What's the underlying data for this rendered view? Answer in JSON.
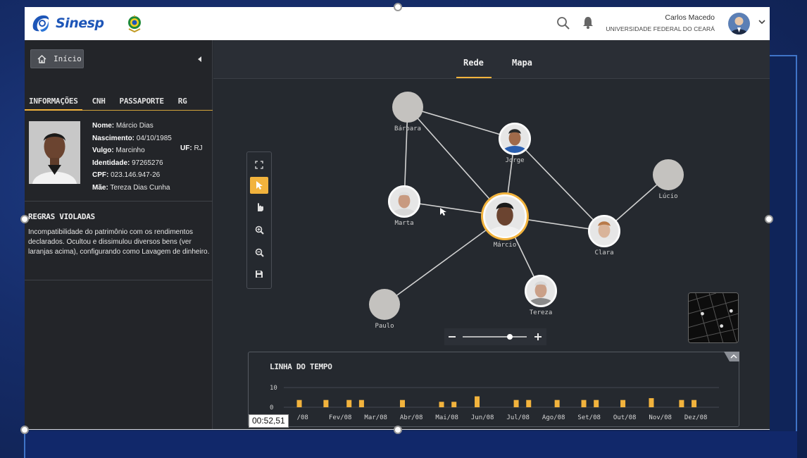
{
  "header": {
    "logo_text": "Sinesp",
    "user_name": "Carlos Macedo",
    "user_org": "UNIVERSIDADE FEDERAL DO CEARÁ"
  },
  "sidebar": {
    "home_label": "Início",
    "tabs": [
      "INFORMAÇÕES",
      "CNH",
      "PASSAPORTE",
      "RG"
    ],
    "active_tab": "INFORMAÇÕES",
    "person": {
      "nome_label": "Nome:",
      "nome": "Márcio Dias",
      "nascimento_label": "Nascimento:",
      "nascimento": "04/10/1985",
      "vulgo_label": "Vulgo:",
      "vulgo": "Marcinho",
      "uf_label": "UF:",
      "uf": "RJ",
      "identidade_label": "Identidade:",
      "identidade": "97265276",
      "cpf_label": "CPF:",
      "cpf": "023.146.947-26",
      "mae_label": "Mãe:",
      "mae": "Tereza Dias Cunha"
    },
    "rules_title": "REGRAS VIOLADAS",
    "rules_text": "Incompatibilidade do patrimônio com os rendimentos declarados. Ocultou e dissimulou diversos bens (ver laranjas acima), configurando como Lavagem de dinheiro."
  },
  "main": {
    "tabs": [
      "Rede",
      "Mapa"
    ],
    "active_tab": "Rede"
  },
  "graph": {
    "nodes": [
      {
        "id": "barbara",
        "label": "Bárbara",
        "photo": false
      },
      {
        "id": "jorge",
        "label": "Jorge",
        "photo": true
      },
      {
        "id": "lucio",
        "label": "Lúcio",
        "photo": false
      },
      {
        "id": "marta",
        "label": "Marta",
        "photo": true
      },
      {
        "id": "marcio",
        "label": "Márcio",
        "photo": true,
        "highlighted": true
      },
      {
        "id": "clara",
        "label": "Clara",
        "photo": true
      },
      {
        "id": "tereza",
        "label": "Tereza",
        "photo": true
      },
      {
        "id": "paulo",
        "label": "Paulo",
        "photo": false
      }
    ],
    "edges": [
      [
        "barbara",
        "jorge"
      ],
      [
        "barbara",
        "marcio"
      ],
      [
        "barbara",
        "marta"
      ],
      [
        "jorge",
        "marcio"
      ],
      [
        "jorge",
        "clara"
      ],
      [
        "marta",
        "marcio"
      ],
      [
        "marcio",
        "clara"
      ],
      [
        "marcio",
        "tereza"
      ],
      [
        "marcio",
        "paulo"
      ],
      [
        "clara",
        "lucio"
      ]
    ]
  },
  "timeline": {
    "title": "LINHA DO TEMPO",
    "timestamp": "00:52,51"
  },
  "chart_data": {
    "type": "bar",
    "title": "LINHA DO TEMPO",
    "ylim": [
      0,
      12
    ],
    "yticks": [
      "10",
      "0"
    ],
    "months": [
      "Jan/08",
      "Fev/08",
      "Mar/08",
      "Abr/08",
      "Mai/08",
      "Jun/08",
      "Jul/08",
      "Ago/08",
      "Set/08",
      "Out/08",
      "Nov/08",
      "Dez/08"
    ],
    "visible_month_labels": [
      "/08",
      "Fev/08",
      "Mar/08",
      "Abr/08",
      "Mai/08",
      "Jun/08",
      "Jul/08",
      "Ago/08",
      "Set/08",
      "Out/08",
      "Nov/08",
      "Dez/08"
    ],
    "bars": [
      {
        "month_index": 0.0,
        "value": 4
      },
      {
        "month_index": 0.75,
        "value": 4
      },
      {
        "month_index": 1.4,
        "value": 4
      },
      {
        "month_index": 1.75,
        "value": 4
      },
      {
        "month_index": 2.9,
        "value": 4
      },
      {
        "month_index": 4.0,
        "value": 3
      },
      {
        "month_index": 4.35,
        "value": 3
      },
      {
        "month_index": 5.0,
        "value": 6
      },
      {
        "month_index": 6.1,
        "value": 4
      },
      {
        "month_index": 6.45,
        "value": 4
      },
      {
        "month_index": 7.25,
        "value": 4
      },
      {
        "month_index": 8.0,
        "value": 4
      },
      {
        "month_index": 8.35,
        "value": 4
      },
      {
        "month_index": 9.1,
        "value": 4
      },
      {
        "month_index": 9.9,
        "value": 5
      },
      {
        "month_index": 10.75,
        "value": 4
      },
      {
        "month_index": 11.1,
        "value": 4
      }
    ],
    "bar_color": "#f2b33d",
    "grid": true
  },
  "colors": {
    "accent": "#f2b33d",
    "brand": "#1e56b8",
    "panel": "#262a30"
  }
}
